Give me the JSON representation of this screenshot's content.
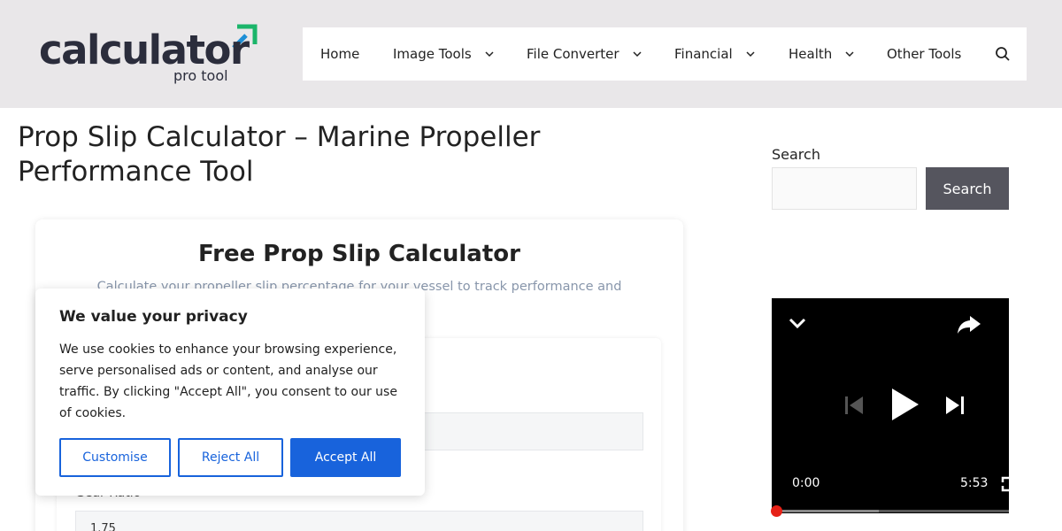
{
  "logo": {
    "main": "calculator",
    "sub": "pro tool",
    "accent_colors": [
      "#1bb56a",
      "#1e8fd6"
    ]
  },
  "nav": {
    "items": [
      {
        "label": "Home",
        "has_dropdown": false
      },
      {
        "label": "Image Tools",
        "has_dropdown": true
      },
      {
        "label": "File Converter",
        "has_dropdown": true
      },
      {
        "label": "Financial",
        "has_dropdown": true
      },
      {
        "label": "Health",
        "has_dropdown": true
      },
      {
        "label": "Other Tools",
        "has_dropdown": false
      }
    ],
    "search_icon": "search-icon"
  },
  "page": {
    "title": "Prop Slip Calculator – Marine Propeller Performance Tool"
  },
  "calculator": {
    "title": "Free Prop Slip Calculator",
    "description": "Calculate your propeller slip percentage for your vessel to track performance and",
    "gear_ratio_label": "Gear Ratio",
    "gear_ratio_value": "1.75"
  },
  "cookie": {
    "title": "We value your privacy",
    "text": "We use cookies to enhance your browsing experience, serve personalised ads or content, and analyse our traffic. By clicking \"Accept All\", you consent to our use of cookies.",
    "customise": "Customise",
    "reject": "Reject All",
    "accept": "Accept All",
    "accent_color": "#1863dc"
  },
  "sidebar": {
    "search_label": "Search",
    "search_placeholder": "",
    "search_button": "Search"
  },
  "video": {
    "current_time": "0:00",
    "duration": "5:53",
    "played_fraction": 0,
    "buffered_fraction": 0.45,
    "icons": [
      "chevron-down-icon",
      "share-icon",
      "previous-icon",
      "play-icon",
      "next-icon",
      "fullscreen-icon"
    ]
  }
}
